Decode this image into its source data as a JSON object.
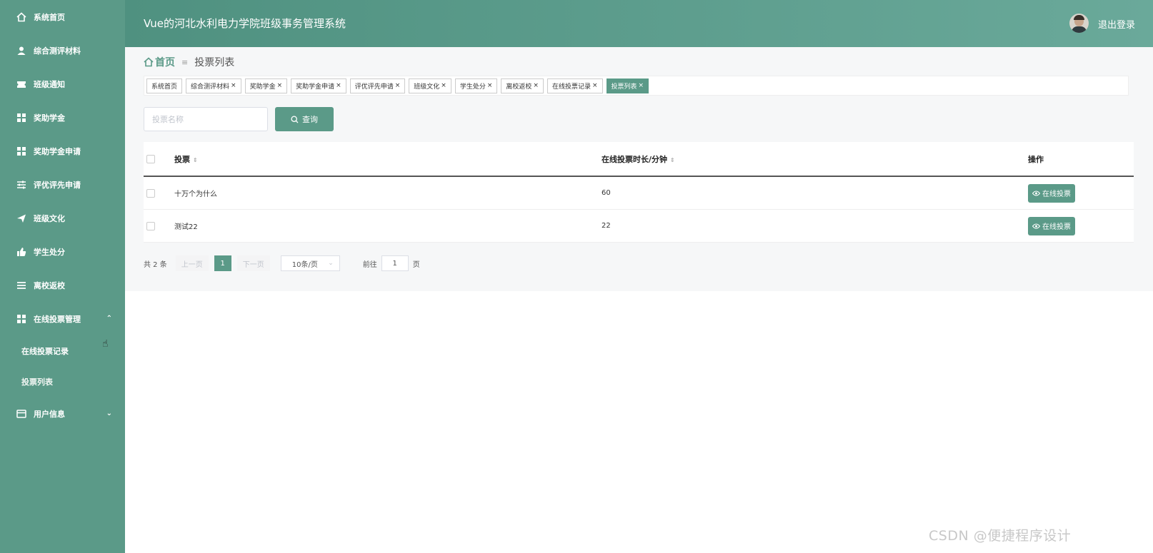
{
  "header": {
    "title": "Vue的河北水利电力学院班级事务管理系统",
    "logout_label": "退出登录"
  },
  "sidebar": {
    "items": [
      {
        "label": "系统首页",
        "icon": "home-icon"
      },
      {
        "label": "综合测评材料",
        "icon": "user-icon"
      },
      {
        "label": "班级通知",
        "icon": "ticket-icon"
      },
      {
        "label": "奖助学金",
        "icon": "grid-icon"
      },
      {
        "label": "奖助学金申请",
        "icon": "grid-icon"
      },
      {
        "label": "评优评先申请",
        "icon": "sliders-icon"
      },
      {
        "label": "班级文化",
        "icon": "send-icon"
      },
      {
        "label": "学生处分",
        "icon": "thumb-icon"
      },
      {
        "label": "离校返校",
        "icon": "list-icon"
      },
      {
        "label": "在线投票管理",
        "icon": "grid-icon",
        "expanded": true
      }
    ],
    "sub_items": [
      {
        "label": "在线投票记录"
      },
      {
        "label": "投票列表"
      }
    ],
    "last_item": {
      "label": "用户信息",
      "icon": "card-icon"
    }
  },
  "breadcrumb": {
    "home": "首页",
    "current": "投票列表"
  },
  "tags": [
    {
      "label": "系统首页",
      "closable": false
    },
    {
      "label": "综合测评材料",
      "closable": true
    },
    {
      "label": "奖助学金",
      "closable": true
    },
    {
      "label": "奖助学金申请",
      "closable": true
    },
    {
      "label": "评优评先申请",
      "closable": true
    },
    {
      "label": "班级文化",
      "closable": true
    },
    {
      "label": "学生处分",
      "closable": true
    },
    {
      "label": "离校返校",
      "closable": true
    },
    {
      "label": "在线投票记录",
      "closable": true
    },
    {
      "label": "投票列表",
      "closable": true,
      "active": true
    }
  ],
  "search": {
    "placeholder": "投票名称",
    "button_label": "查询"
  },
  "table": {
    "columns": [
      "投票",
      "在线投票时长/分钟",
      "操作"
    ],
    "rows": [
      {
        "name": "十万个为什么",
        "duration": "60",
        "action": "在线投票"
      },
      {
        "name": "测试22",
        "duration": "22",
        "action": "在线投票"
      }
    ]
  },
  "pagination": {
    "total_text": "共 2 条",
    "prev": "上一页",
    "current": "1",
    "next": "下一页",
    "page_size": "10条/页",
    "goto_label": "前往",
    "goto_value": "1",
    "page_suffix": "页"
  },
  "watermark": "CSDN @便捷程序设计",
  "colors": {
    "primary": "#5b9a88",
    "header_start": "#4f9180",
    "header_end": "#6aa99a"
  }
}
